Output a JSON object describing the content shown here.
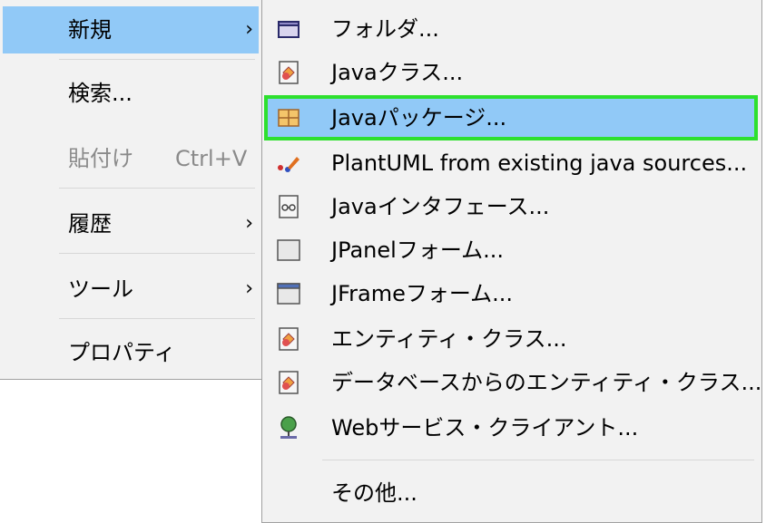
{
  "main_menu": {
    "items": [
      {
        "label": "新規",
        "arrow": "›"
      },
      {
        "label": "検索..."
      },
      {
        "label": "貼付け",
        "shortcut": "Ctrl+V"
      },
      {
        "label": "履歴",
        "arrow": "›"
      },
      {
        "label": "ツール",
        "arrow": "›"
      },
      {
        "label": "プロパティ"
      }
    ]
  },
  "sub_menu": {
    "items": [
      {
        "label": "フォルダ...",
        "icon": "folder-icon"
      },
      {
        "label": "Javaクラス...",
        "icon": "java-class-icon"
      },
      {
        "label": "Javaパッケージ...",
        "icon": "java-package-icon"
      },
      {
        "label": "PlantUML from existing java sources...",
        "icon": "plantuml-icon"
      },
      {
        "label": "Javaインタフェース...",
        "icon": "java-interface-icon"
      },
      {
        "label": "JPanelフォーム...",
        "icon": "jpanel-form-icon"
      },
      {
        "label": "JFrameフォーム...",
        "icon": "jframe-form-icon"
      },
      {
        "label": "エンティティ・クラス...",
        "icon": "entity-class-icon"
      },
      {
        "label": "データベースからのエンティティ・クラス...",
        "icon": "entity-from-database-icon"
      },
      {
        "label": "Webサービス・クライアント...",
        "icon": "web-service-client-icon"
      },
      {
        "label": "その他..."
      }
    ]
  },
  "colors": {
    "highlight": "#91c9f7",
    "focus_outline": "#2ee02e",
    "menu_background": "#f2f2f2",
    "disabled_text": "#8a8a8a"
  }
}
